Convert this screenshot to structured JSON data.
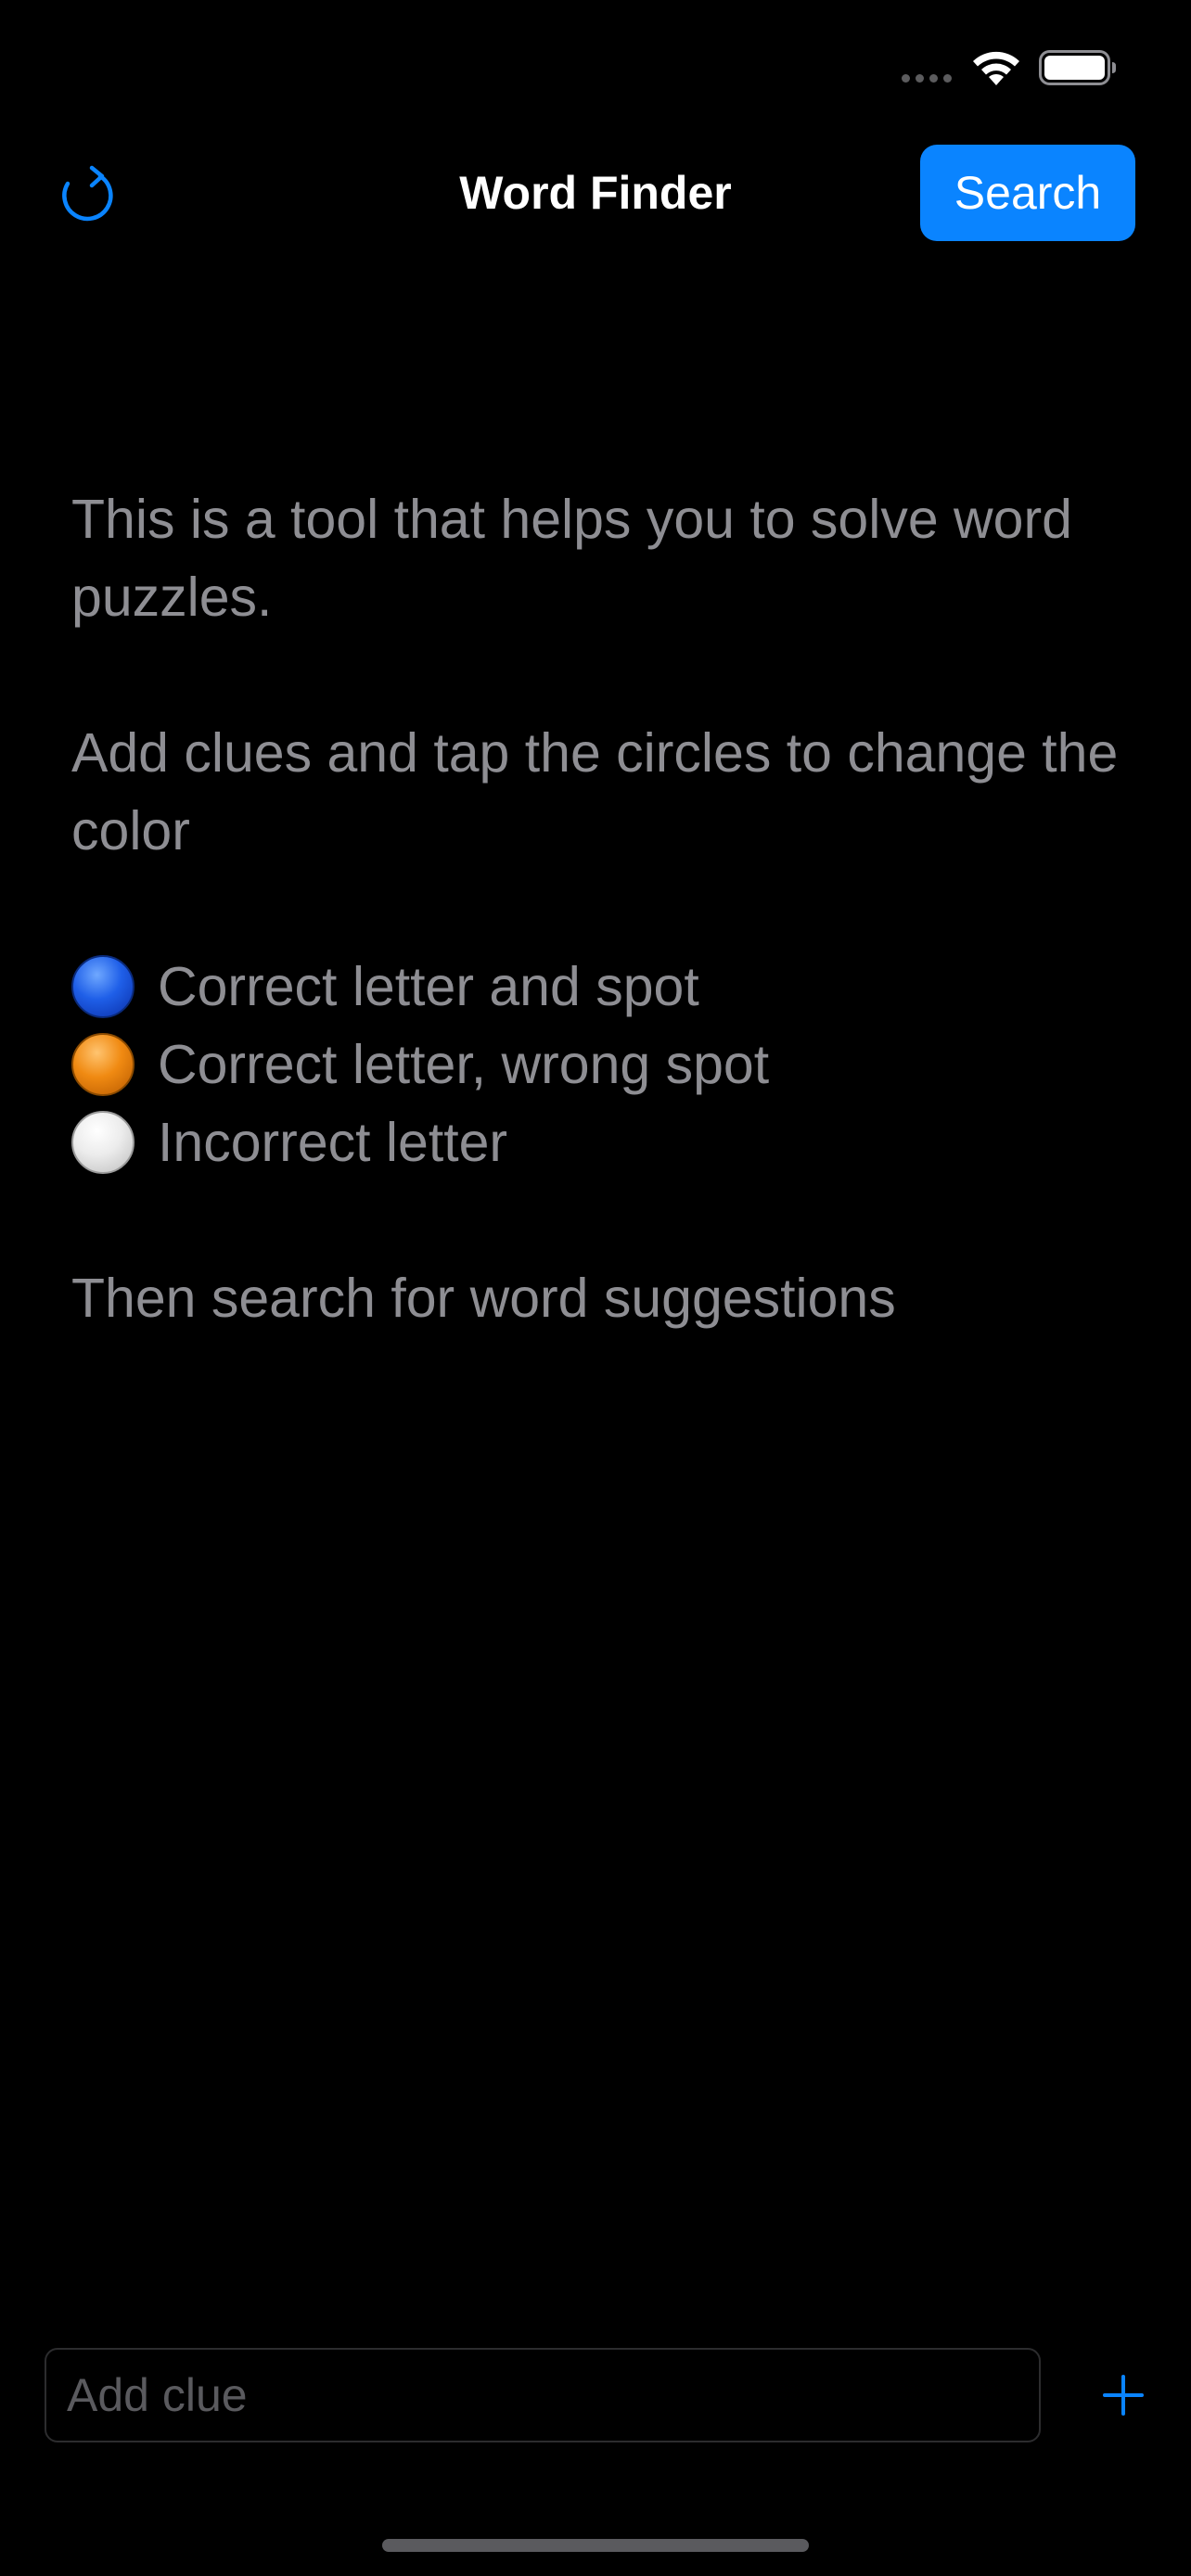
{
  "status_bar": {
    "wifi_icon": "wifi-icon",
    "battery_icon": "battery-icon"
  },
  "nav": {
    "title": "Word Finder",
    "refresh_icon": "refresh-icon",
    "search_label": "Search"
  },
  "intro": {
    "paragraph1": "This is a tool that helps you to solve word puzzles.",
    "paragraph2": "Add clues and tap the circles to change the color",
    "legend": [
      {
        "color": "#1f5fe8",
        "label": "Correct letter and spot"
      },
      {
        "color": "#f08a12",
        "label": "Correct letter, wrong spot"
      },
      {
        "color": "#ececec",
        "label": "Incorrect letter"
      }
    ],
    "paragraph3": "Then search for word suggestions"
  },
  "clue_input": {
    "placeholder": "Add clue",
    "value": ""
  },
  "add_button": {
    "icon": "plus-icon"
  },
  "colors": {
    "accent": "#0a84ff",
    "background": "#000000",
    "body_text": "#8e8e93"
  }
}
